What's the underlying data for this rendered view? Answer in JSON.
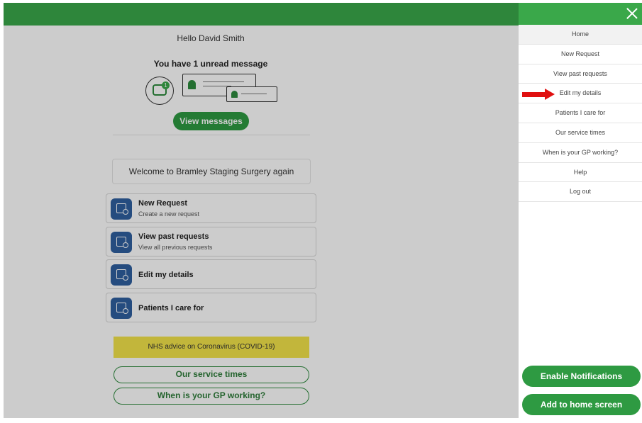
{
  "header": {
    "color": "#3aa84a"
  },
  "main": {
    "greeting": "Hello David Smith",
    "unread_message": "You have 1 unread message",
    "unread_count": "1",
    "view_messages_label": "View messages",
    "welcome": "Welcome to Bramley Staging Surgery again",
    "cards": [
      {
        "title": "New Request",
        "subtitle": "Create a new request",
        "icon": "calendar-clock-icon"
      },
      {
        "title": "View past requests",
        "subtitle": "View all previous requests",
        "icon": "calendar-clock-icon"
      },
      {
        "title": "Edit my details",
        "subtitle": "",
        "icon": "calendar-clock-icon"
      },
      {
        "title": "Patients I care for",
        "subtitle": "",
        "icon": "calendar-clock-icon"
      }
    ],
    "nhs_advice": "NHS advice on Coronavirus (COVID-19)",
    "service_times_label": "Our service times",
    "gp_working_label": "When is your GP working?"
  },
  "drawer": {
    "close_icon": "close-icon",
    "menu": [
      {
        "label": "Home",
        "active": true
      },
      {
        "label": "New Request"
      },
      {
        "label": "View past requests"
      },
      {
        "label": "Edit my details"
      },
      {
        "label": "Patients I care for"
      },
      {
        "label": "Our service times"
      },
      {
        "label": "When is your GP working?"
      },
      {
        "label": "Help"
      },
      {
        "label": "Log out"
      }
    ],
    "enable_notifications_label": "Enable Notifications",
    "add_to_home_label": "Add to home screen"
  },
  "annotation": {
    "arrow_color": "#e01010",
    "points_to": "Edit my details"
  },
  "colors": {
    "brand_green": "#3aa84a",
    "button_green": "#2e9a42",
    "icon_blue": "#2f5f9f",
    "nhs_yellow": "#f3e44a"
  }
}
